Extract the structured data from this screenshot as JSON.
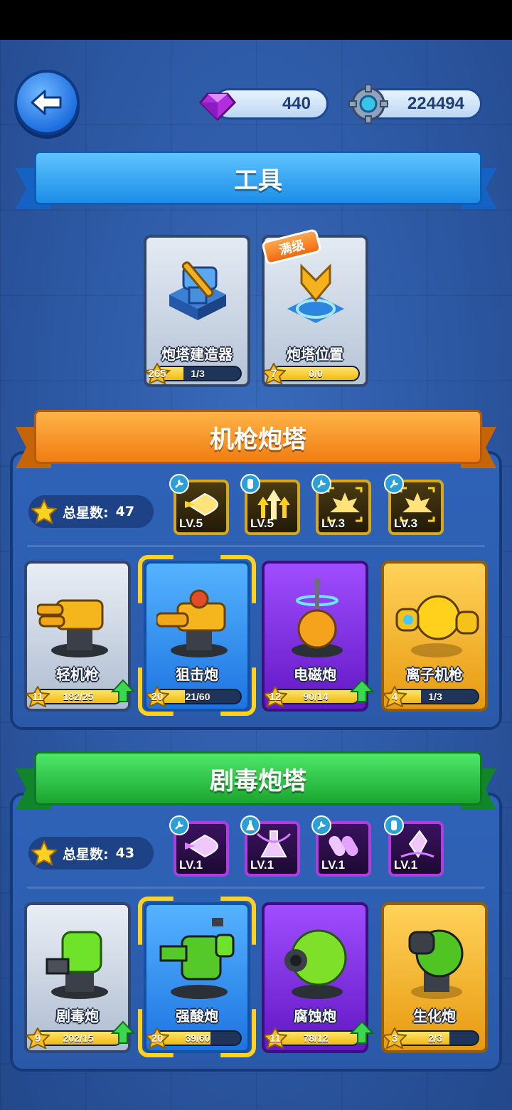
{
  "header": {
    "gems": "440",
    "gears": "224494"
  },
  "tools": {
    "title": "工具",
    "cards": [
      {
        "name": "炮塔建造器",
        "level": "265",
        "progress": "1/3",
        "fill": 0.33
      },
      {
        "name": "炮塔位置",
        "level": "7",
        "progress": "0/0",
        "fill": 1.0,
        "tag": "满级"
      }
    ]
  },
  "machinegun": {
    "title": "机枪炮塔",
    "stars_label": "总星数:",
    "stars": "47",
    "upgrades": [
      {
        "level": "LV.5",
        "icon": "bullet-icon",
        "tag": "wrench-icon"
      },
      {
        "level": "LV.5",
        "icon": "arrows-up-icon",
        "tag": "potion-icon"
      },
      {
        "level": "LV.3",
        "icon": "explosion-icon",
        "tag": "wrench-icon"
      },
      {
        "level": "LV.3",
        "icon": "explosion-icon",
        "tag": "wrench-icon"
      }
    ],
    "turrets": [
      {
        "name": "轻机枪",
        "level": "11",
        "progress": "182/25",
        "fill": 1.0,
        "rarity": "white",
        "upgradable": true
      },
      {
        "name": "狙击炮",
        "level": "20",
        "progress": "21/60",
        "fill": 0.35,
        "rarity": "blue",
        "selected": true
      },
      {
        "name": "电磁炮",
        "level": "12",
        "progress": "90/14",
        "fill": 1.0,
        "rarity": "purple",
        "upgradable": true
      },
      {
        "name": "离子机枪",
        "level": "4",
        "progress": "1/3",
        "fill": 0.33,
        "rarity": "gold"
      }
    ]
  },
  "poison": {
    "title": "剧毒炮塔",
    "stars_label": "总星数:",
    "stars": "43",
    "upgrades": [
      {
        "level": "LV.1",
        "icon": "bullet-icon",
        "tag": "wrench-icon"
      },
      {
        "level": "LV.1",
        "icon": "flask-icon",
        "tag": "flask-icon"
      },
      {
        "level": "LV.1",
        "icon": "shells-icon",
        "tag": "wrench-icon"
      },
      {
        "level": "LV.1",
        "icon": "crystal-icon",
        "tag": "potion-icon"
      }
    ],
    "turrets": [
      {
        "name": "剧毒炮",
        "level": "9",
        "progress": "202/15",
        "fill": 1.0,
        "rarity": "white",
        "upgradable": true
      },
      {
        "name": "强酸炮",
        "level": "20",
        "progress": "39/60",
        "fill": 0.65,
        "rarity": "blue",
        "selected": true
      },
      {
        "name": "腐蚀炮",
        "level": "11",
        "progress": "78/12",
        "fill": 1.0,
        "rarity": "purple",
        "upgradable": true
      },
      {
        "name": "生化炮",
        "level": "3",
        "progress": "2/3",
        "fill": 0.67,
        "rarity": "gold"
      }
    ]
  }
}
